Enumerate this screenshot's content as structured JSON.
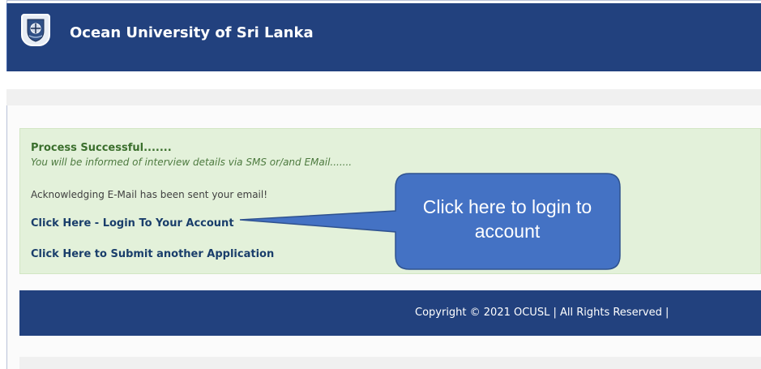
{
  "header": {
    "logo_icon": "ocean-university-crest-icon",
    "site_title": "Ocean University of Sri Lanka"
  },
  "message": {
    "title": "Process Successful.......",
    "subtitle": "You will be informed of interview details via SMS or/and EMail.......",
    "acknowledgement": "Acknowledging E-Mail has been sent your email!"
  },
  "links": {
    "login": "Click Here - Login To Your Account",
    "submit_another": "Click Here to Submit another Application"
  },
  "callout": {
    "line1": "Click here to login to",
    "line2": "account"
  },
  "footer": {
    "copyright": "Copyright © 2021 OCUSL | All Rights Reserved |"
  },
  "colors": {
    "header_bg": "#22417e",
    "success_bg": "#e3f1da",
    "callout_fill": "#4472c4"
  }
}
